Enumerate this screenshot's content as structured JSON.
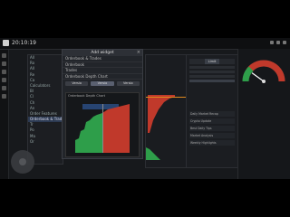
{
  "header": {
    "clock": "20:10:19"
  },
  "nav": {
    "items": [
      "All",
      "Ro",
      "All",
      "Re",
      "Ca",
      "Calculators",
      "Bl",
      "Cl",
      "Ch",
      "An",
      "Order Features",
      "Orderbook & Trades",
      "Tr",
      "Po",
      "Ma",
      "Or"
    ],
    "active_index": 11
  },
  "dialog": {
    "title": "Add widget",
    "options": [
      "Orderbook & Trades",
      "Orderbook",
      "Trades",
      "Orderbook Depth Chart"
    ],
    "mode_buttons": [
      "Versio",
      "Versio",
      "Versio"
    ],
    "selected_button": 1,
    "preview_title": "Orderbook Depth Chart",
    "preview_subtitle": ""
  },
  "chart": {
    "label": "",
    "price_marker": ""
  },
  "order_panel": {
    "tabs": [
      "",
      "Limit",
      ""
    ],
    "active_tab": 1
  },
  "news": [
    "Daily Market Recap",
    "Crypto Update",
    "Best Daily Tips",
    "Market Analysis",
    "Weekly Highlights"
  ],
  "gauge": {
    "title": "",
    "label": "",
    "value_fraction": 0.2
  },
  "colors": {
    "bid": "#2e9e4a",
    "ask": "#c0392b",
    "accent": "#274472",
    "orange": "#e08a1e"
  }
}
